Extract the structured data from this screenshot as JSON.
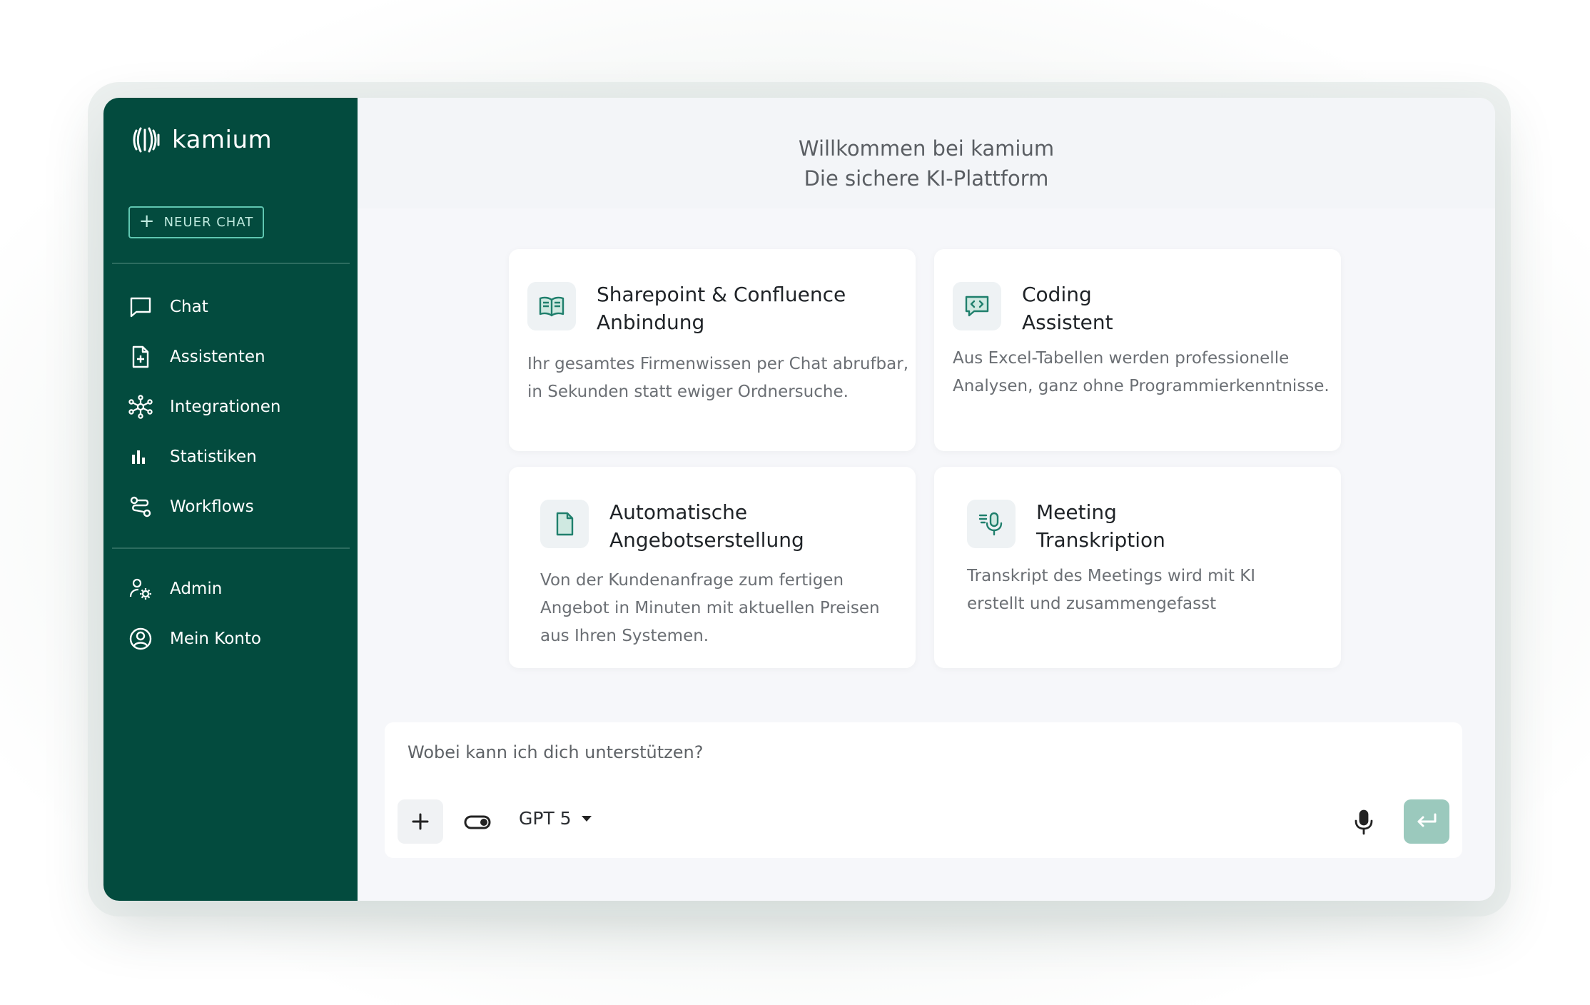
{
  "app": {
    "name": "kamium"
  },
  "sidebar": {
    "new_chat_label": "NEUER CHAT",
    "primary_items": [
      {
        "label": "Chat",
        "icon": "chat-bubble-icon"
      },
      {
        "label": "Assistenten",
        "icon": "document-plus-icon"
      },
      {
        "label": "Integrationen",
        "icon": "network-hub-icon"
      },
      {
        "label": "Statistiken",
        "icon": "bar-chart-icon"
      },
      {
        "label": "Workflows",
        "icon": "workflow-icon"
      }
    ],
    "secondary_items": [
      {
        "label": "Admin",
        "icon": "admin-user-gear-icon"
      },
      {
        "label": "Mein Konto",
        "icon": "account-circle-icon"
      }
    ]
  },
  "header": {
    "line1": "Willkommen bei kamium",
    "line2": "Die sichere KI-Plattform"
  },
  "cards": [
    {
      "title_line1": "Sharepoint & Confluence",
      "title_line2": "Anbindung",
      "desc_line1": "Ihr gesamtes Firmenwissen per Chat abrufbar,",
      "desc_line2": "in Sekunden statt ewiger Ordnersuche.",
      "desc_line3": "",
      "icon": "open-book-icon"
    },
    {
      "title_line1": "Coding",
      "title_line2": "Assistent",
      "desc_line1": "Aus Excel-Tabellen werden professionelle",
      "desc_line2": "Analysen, ganz ohne Programmierkenntnisse.",
      "desc_line3": "",
      "icon": "code-chat-icon"
    },
    {
      "title_line1": "Automatische",
      "title_line2": "Angebotserstellung",
      "desc_line1": "Von der Kundenanfrage zum fertigen",
      "desc_line2": "Angebot in Minuten mit aktuellen Preisen",
      "desc_line3": "aus Ihren Systemen.",
      "icon": "document-icon"
    },
    {
      "title_line1": "Meeting",
      "title_line2": "Transkription",
      "desc_line1": "Transkript des Meetings wird mit KI",
      "desc_line2": "erstellt und zusammengefasst",
      "desc_line3": "",
      "icon": "microphone-transcript-icon"
    }
  ],
  "composer": {
    "placeholder": "Wobei kann ich dich unterstützen?",
    "model": "GPT 5"
  },
  "colors": {
    "sidebar": "#034b3e",
    "accent": "#5fc7b1",
    "icon_accent": "#1f7f6c",
    "send_button": "#9bc9bd"
  }
}
